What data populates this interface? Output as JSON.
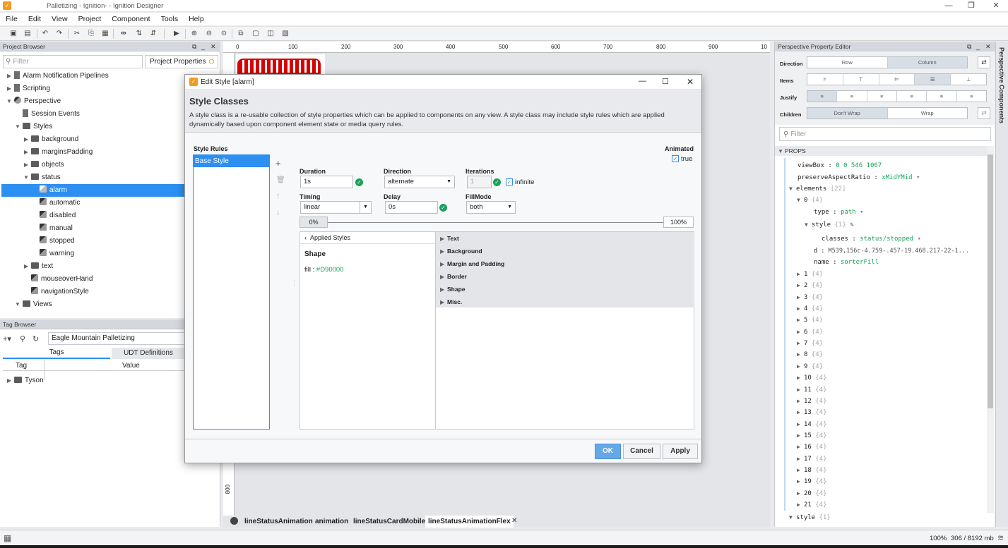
{
  "window": {
    "title": "Palletizing - Ignition- - Ignition Designer"
  },
  "menu": [
    "File",
    "Edit",
    "View",
    "Project",
    "Component",
    "Tools",
    "Help"
  ],
  "project_browser": {
    "title": "Project Browser",
    "filter_placeholder": "Filter",
    "properties_button": "Project Properties",
    "items": [
      {
        "label": "Alarm Notification Pipelines",
        "level": 0
      },
      {
        "label": "Scripting",
        "level": 0
      },
      {
        "label": "Perspective",
        "level": 0
      },
      {
        "label": "Session Events",
        "level": 1
      },
      {
        "label": "Styles",
        "level": 1
      },
      {
        "label": "background",
        "level": 2
      },
      {
        "label": "marginsPadding",
        "level": 2
      },
      {
        "label": "objects",
        "level": 2
      },
      {
        "label": "status",
        "level": 2
      },
      {
        "label": "alarm",
        "level": 3
      },
      {
        "label": "automatic",
        "level": 3
      },
      {
        "label": "disabled",
        "level": 3
      },
      {
        "label": "manual",
        "level": 3
      },
      {
        "label": "stopped",
        "level": 3
      },
      {
        "label": "warning",
        "level": 3
      },
      {
        "label": "text",
        "level": 2
      },
      {
        "label": "mouseoverHand",
        "level": 2
      },
      {
        "label": "navigationStyle",
        "level": 2
      },
      {
        "label": "Views",
        "level": 1
      }
    ]
  },
  "tag_browser": {
    "title": "Tag Browser",
    "provider": "Eagle Mountain Palletizing",
    "tabs": [
      "Tags",
      "UDT Definitions"
    ],
    "columns": [
      "Tag",
      "Value"
    ],
    "rows": [
      "Tyson"
    ]
  },
  "canvas": {
    "ruler_ticks": [
      "0",
      "100",
      "200",
      "300",
      "400",
      "500",
      "600",
      "700",
      "800",
      "900",
      "10"
    ],
    "vertical_tick": "800"
  },
  "dialog": {
    "title": "Edit Style [alarm]",
    "heading": "Style Classes",
    "description": "A style class is a re-usable collection of style properties which can be applied to components on any view. A style class may include style rules which are applied dynamically based upon component element state or media query rules.",
    "style_rules_label": "Style Rules",
    "rules": [
      "Base Style"
    ],
    "animated_label": "Animated",
    "animated_value": "true",
    "duration": {
      "label": "Duration",
      "value": "1s"
    },
    "direction": {
      "label": "Direction",
      "value": "alternate"
    },
    "iterations": {
      "label": "Iterations",
      "value": "1",
      "infinite_label": "infinite"
    },
    "timing": {
      "label": "Timing",
      "value": "linear"
    },
    "delay": {
      "label": "Delay",
      "value": "0s"
    },
    "fillmode": {
      "label": "FillMode",
      "value": "both"
    },
    "keyframe_start": "0%",
    "keyframe_end": "100%",
    "applied_styles_label": "Applied Styles",
    "applied_group": "Shape",
    "applied_prop_name": "fill",
    "applied_prop_value": "#D90000",
    "sections": [
      "Text",
      "Background",
      "Margin and Padding",
      "Border",
      "Shape",
      "Misc."
    ],
    "buttons": {
      "ok": "OK",
      "cancel": "Cancel",
      "apply": "Apply"
    }
  },
  "property_editor": {
    "title": "Perspective Property Editor",
    "direction_label": "Direction",
    "direction_options": [
      "Row",
      "Column"
    ],
    "items_label": "Items",
    "justify_label": "Justify",
    "children_label": "Children",
    "children_options": [
      "Don't Wrap",
      "Wrap"
    ],
    "filter_placeholder": "Filter",
    "props_header": "PROPS",
    "viewbox": {
      "key": "viewBox",
      "value": "0 0 546 1067"
    },
    "aspect": {
      "key": "preserveAspectRatio",
      "value": "xMidYMid"
    },
    "elements": {
      "key": "elements",
      "count": "[22]"
    },
    "el0": {
      "key": "0",
      "count": "{4}"
    },
    "type": {
      "key": "type",
      "value": "path"
    },
    "style": {
      "key": "style",
      "count": "{1}"
    },
    "classes": {
      "key": "classes",
      "value": "status/stopped"
    },
    "d": {
      "key": "d",
      "value": "M539,156c-4.759-.457-19.468.217-22-1..."
    },
    "name": {
      "key": "name",
      "value": "sorterFill"
    },
    "element_rows": [
      "1",
      "2",
      "3",
      "4",
      "5",
      "6",
      "7",
      "8",
      "9",
      "10",
      "11",
      "12",
      "13",
      "14",
      "15",
      "16",
      "17",
      "18",
      "19",
      "20",
      "21"
    ],
    "element_count": "{4}",
    "style_root": {
      "key": "style",
      "count": "{1}"
    },
    "side_tab": "Perspective Components"
  },
  "bottom_tabs": [
    "lineStatusAnimation",
    "animation",
    "lineStatusCardMobile",
    "lineStatusAnimationFlex"
  ],
  "status_bar": {
    "zoom": "100%",
    "memory": "306 / 8192 mb"
  },
  "colors": {
    "accent": "#2d8ff0",
    "success": "#16a35a",
    "brand": "#f29b1d",
    "fill": "#D90000"
  }
}
